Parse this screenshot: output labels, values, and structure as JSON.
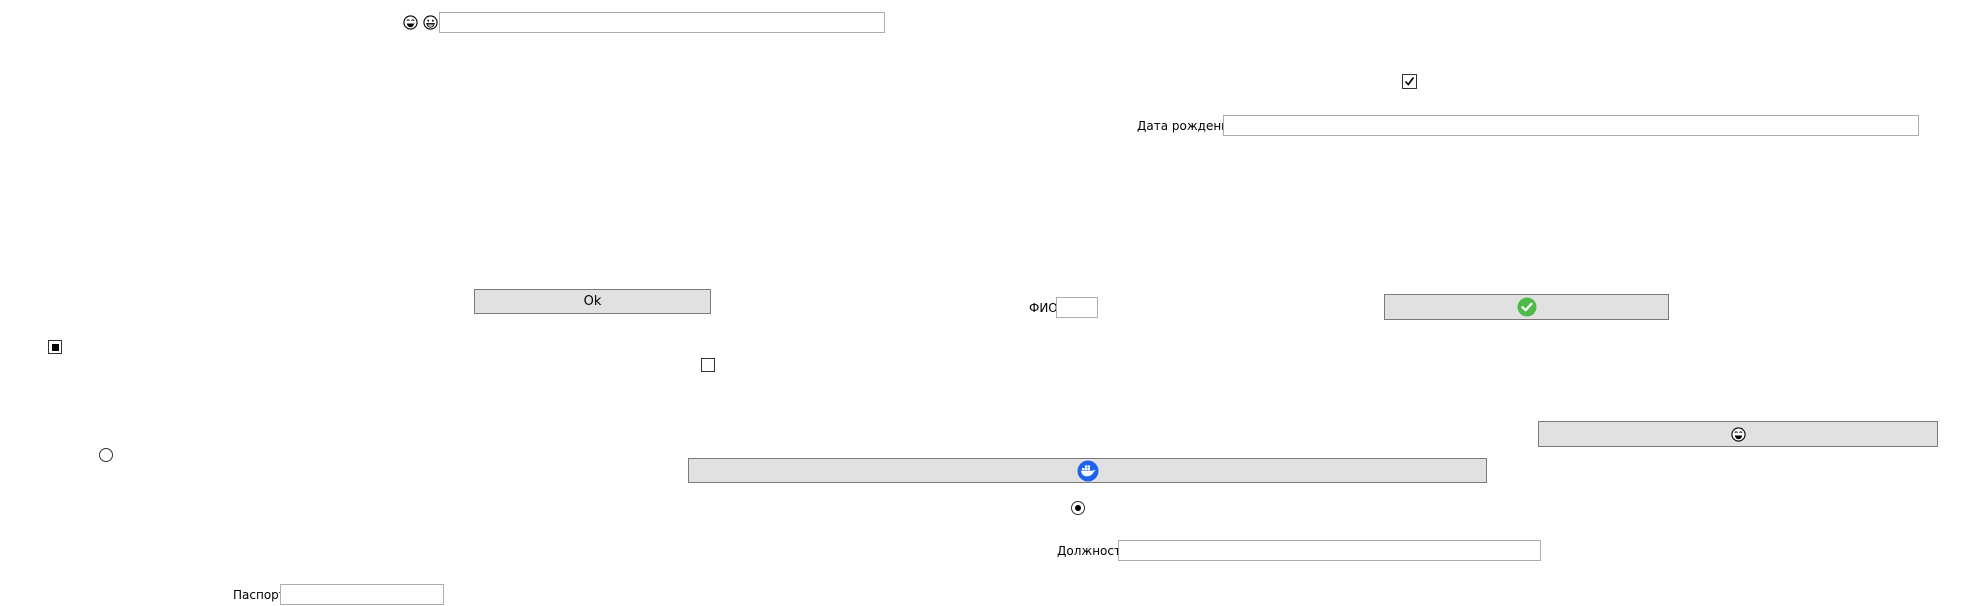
{
  "form": {
    "fio_label": "ФИО",
    "fio_value": "",
    "birth_label": "Дата рождения",
    "birth_value": "",
    "position_label": "Должность",
    "position_value": "",
    "passport_label": "Паспорт",
    "passport_value": "",
    "top_value": ""
  },
  "buttons": {
    "ok_label": "Ok",
    "check_icon": "check-circle-icon",
    "docker_icon": "docker-whale-icon",
    "emoji_icon": "laughing-face-icon"
  },
  "controls": {
    "checkbox_top_checked": true,
    "checkbox_indeterminate": true,
    "checkbox_mid_checked": false,
    "radio_left_checked": false,
    "radio_center_checked": true
  },
  "colors": {
    "button_bg": "#e1e1e1",
    "check_green": "#4cbb47",
    "docker_blue": "#1d63ed"
  }
}
